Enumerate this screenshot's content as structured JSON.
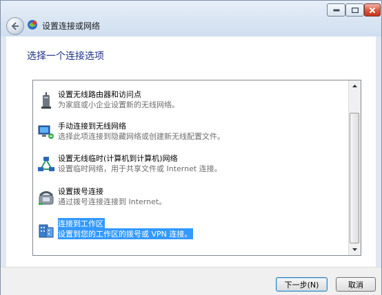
{
  "window": {
    "title": "设置连接或网络"
  },
  "page": {
    "heading": "选择一个连接选项"
  },
  "options": [
    {
      "title": "设置无线路由器和访问点",
      "description": "为家庭或小企业设置新的无线网络。",
      "icon": "wireless-router-icon"
    },
    {
      "title": "手动连接到无线网络",
      "description": "选择此项连接到隐藏网络或创建新无线配置文件。",
      "icon": "network-wireless-icon"
    },
    {
      "title": "设置无线临时(计算机到计算机)网络",
      "description": "设置临时网络，用于共享文件或 Internet 连接。",
      "icon": "ad-hoc-network-icon"
    },
    {
      "title": "设置拨号连接",
      "description": "通过拨号连接连接到 Internet。",
      "icon": "dialup-phone-icon"
    },
    {
      "title": "连接到工作区",
      "description": "设置到您的工作区的拨号或 VPN 连接。",
      "icon": "workplace-icon",
      "selected": true
    }
  ],
  "buttons": {
    "next": "下一步(N)",
    "cancel": "取消"
  },
  "colors": {
    "selection": "#3399ff",
    "heading": "#1e3287"
  }
}
